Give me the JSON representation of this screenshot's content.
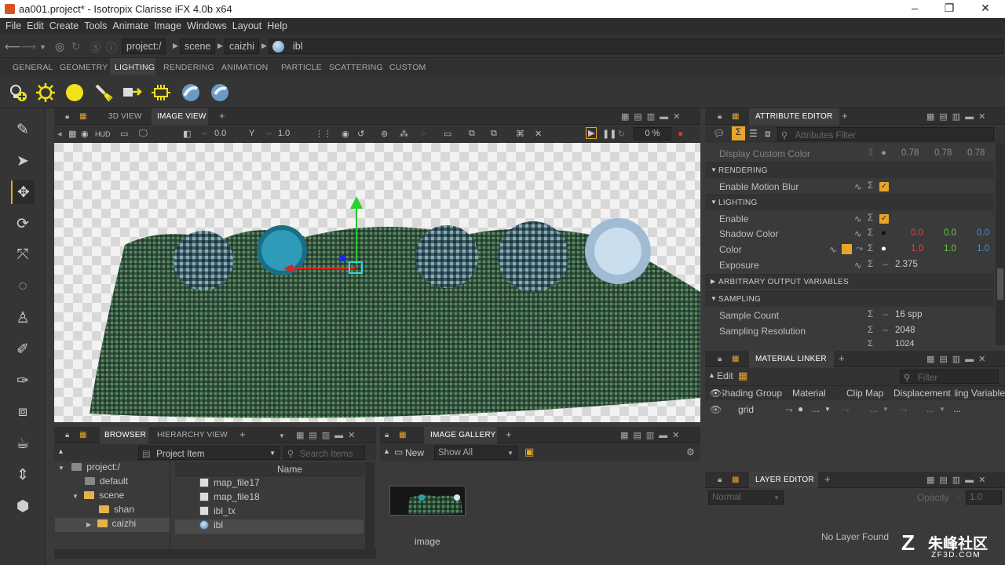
{
  "window": {
    "title": "aa001.project* - Isotropix Clarisse iFX 4.0b x64",
    "min": "–",
    "max": "❐",
    "close": "✕"
  },
  "menu": [
    "File",
    "Edit",
    "Create",
    "Tools",
    "Animate",
    "Image",
    "Windows",
    "Layout",
    "Help"
  ],
  "path": {
    "project": "project:/",
    "scene": "scene",
    "caizhi": "caizhi",
    "current": "ibl"
  },
  "shelf_tabs": [
    "GENERAL",
    "GEOMETRY",
    "LIGHTING",
    "RENDERING",
    "ANIMATION",
    "PARTICLE",
    "SCATTERING",
    "CUSTOM"
  ],
  "shelf_active": "LIGHTING",
  "viewport": {
    "tab_3d": "3D VIEW",
    "tab_image": "IMAGE VIEW",
    "hud": "HUD",
    "exposure": "0.0",
    "gamma_icon": "Y",
    "gamma": "1.0",
    "progress": "0 %"
  },
  "attribute_editor": {
    "title": "ATTRIBUTE EDITOR",
    "filter_placeholder": "Attributes Filter",
    "display_color_label": "Display Custom Color",
    "display_color": [
      "0.78",
      "0.78",
      "0.78"
    ],
    "rendering": "RENDERING",
    "motion_blur": "Enable Motion Blur",
    "lighting": "LIGHTING",
    "enable": "Enable",
    "shadow_color": "Shadow Color",
    "shadow_rgb": [
      "0.0",
      "0.0",
      "0.0"
    ],
    "color": "Color",
    "color_rgb": [
      "1.0",
      "1.0",
      "1.0"
    ],
    "exposure": "Exposure",
    "exposure_val": "2.375",
    "aov": "ARBITRARY OUTPUT VARIABLES",
    "sampling": "SAMPLING",
    "sample_count": "Sample Count",
    "sample_count_val": "16 spp",
    "sampling_res": "Sampling Resolution",
    "sampling_res_val": "2048",
    "cut_val": "1024",
    "colors": {
      "red": "#e04040",
      "green": "#5dcc3a",
      "blue": "#3f8fe6"
    }
  },
  "material_linker": {
    "title": "MATERIAL LINKER",
    "edit": "Edit",
    "filter_placeholder": "Filter",
    "columns": [
      "Shading Group",
      "Material",
      "Clip Map",
      "Displacement",
      "Shading Variable"
    ],
    "row_name": "grid",
    "dots": "..."
  },
  "layer_editor": {
    "title": "LAYER EDITOR",
    "blend": "Normal",
    "opacity_label": "Opacity",
    "opacity": "1.0",
    "empty": "No Layer Found"
  },
  "browser": {
    "tab_browser": "BROWSER",
    "tab_hierarchy": "HIERARCHY VIEW",
    "type_select": "Project Item",
    "search_placeholder": "Search Items",
    "tree": [
      "project:/",
      "default",
      "scene",
      "shan",
      "caizhi"
    ],
    "column_name": "Name",
    "items": [
      "map_file17",
      "map_file18",
      "ibl_tx",
      "ibl"
    ]
  },
  "gallery": {
    "title": "IMAGE GALLERY",
    "new": "New",
    "show": "Show All",
    "image_label": "image"
  },
  "watermark": {
    "brand": "朱峰社区",
    "site": "ZF3D.COM"
  }
}
